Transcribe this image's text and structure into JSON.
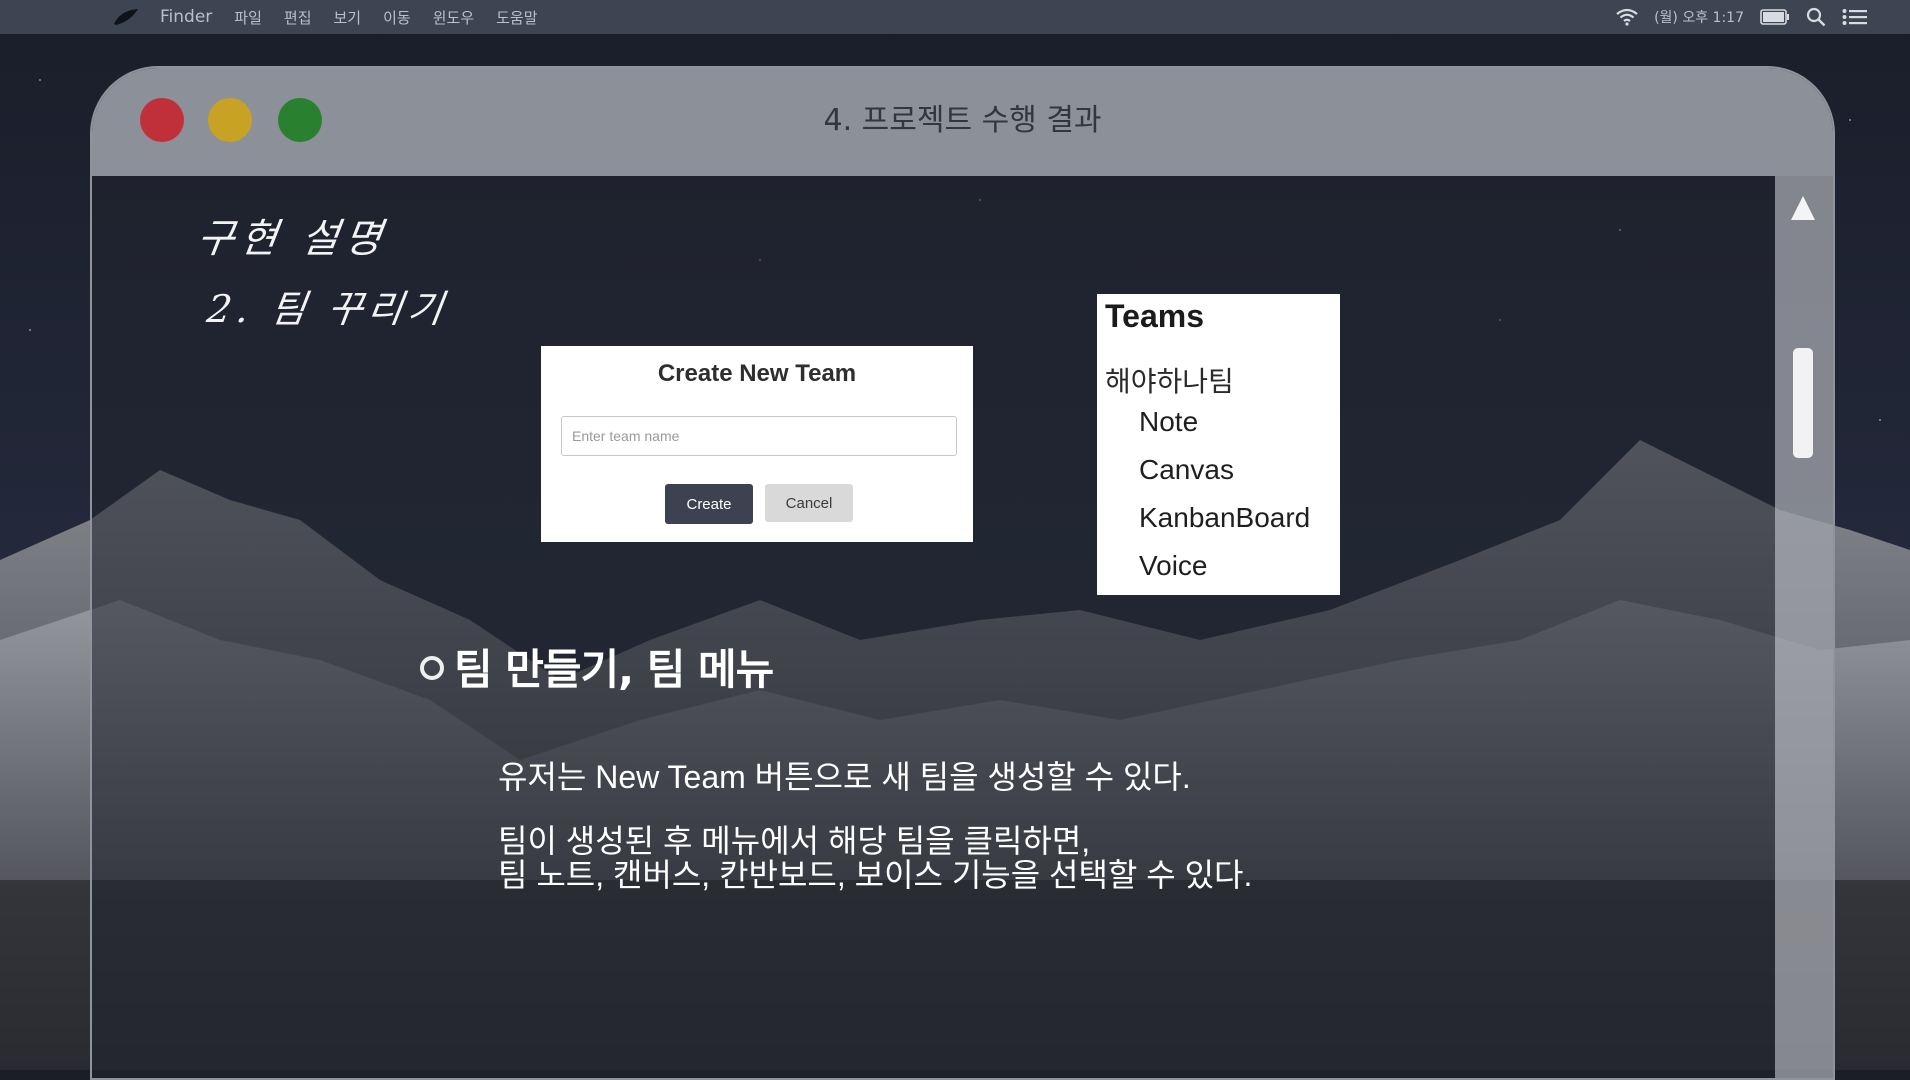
{
  "menubar": {
    "app_name": "Finder",
    "items": [
      "파일",
      "편집",
      "보기",
      "이동",
      "윈도우",
      "도움말"
    ],
    "clock": "(월) 오후 1:17"
  },
  "window": {
    "title": "4. 프로젝트 수행 결과"
  },
  "content": {
    "heading": "구현 설명",
    "subheading": "2. 팀 꾸리기",
    "dialog": {
      "title": "Create New Team",
      "input_placeholder": "Enter team name",
      "create_label": "Create",
      "cancel_label": "Cancel"
    },
    "teams_menu": {
      "heading": "Teams",
      "team_name": "해야하나팀",
      "items": [
        "Note",
        "Canvas",
        "KanbanBoard",
        "Voice"
      ]
    },
    "section_title": "팀 만들기, 팀 메뉴",
    "description": [
      "유저는 New Team 버튼으로 새 팀을 생성할 수 있다.",
      "팀이 생성된 후 메뉴에서 해당 팀을 클릭하면,",
      "팀 노트, 캔버스, 칸반보드, 보이스 기능을 선택할 수 있다."
    ]
  },
  "icons": {
    "apple": "apple-logo-icon",
    "wifi": "wifi-icon",
    "battery": "battery-icon",
    "search": "search-icon",
    "list": "list-icon",
    "moon": "moon-icon",
    "bullet": "circle-bullet-icon"
  },
  "colors": {
    "traffic_red": "#c0303a",
    "traffic_yellow": "#c7a225",
    "traffic_green": "#29802f",
    "create_button": "#3c4250"
  }
}
